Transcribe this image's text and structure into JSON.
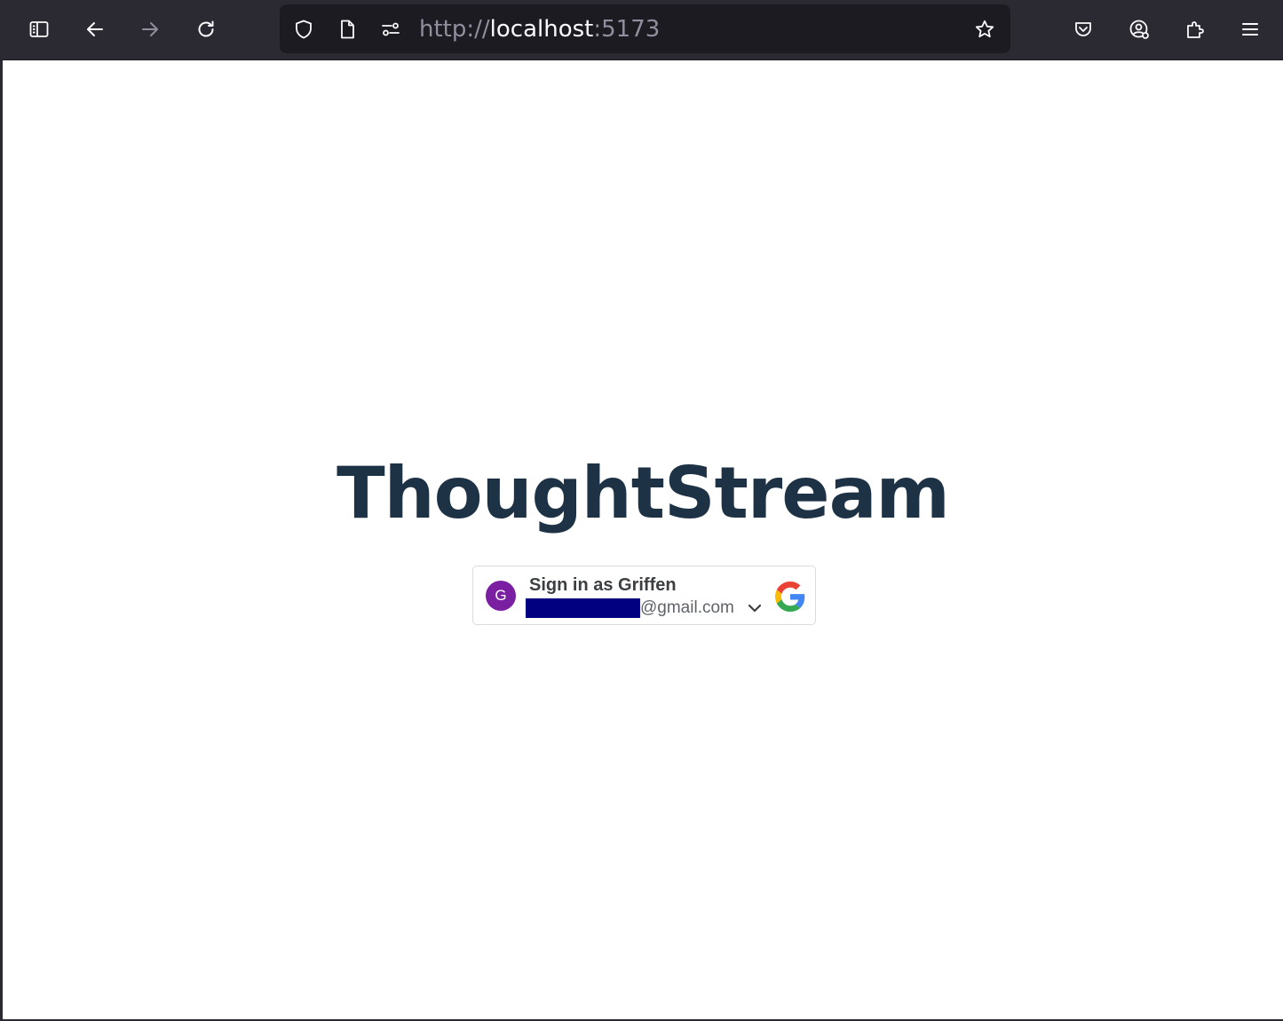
{
  "browser": {
    "url_scheme": "http://",
    "url_host": "localhost",
    "url_port": ":5173",
    "icons": {
      "sidebar": "sidebar-icon",
      "back": "arrow-left-icon",
      "forward": "arrow-right-icon",
      "reload": "reload-icon",
      "shield": "shield-icon",
      "page": "page-icon",
      "permissions": "permissions-icon",
      "bookmark": "star-icon",
      "pocket": "pocket-icon",
      "account": "account-icon",
      "extensions": "puzzle-icon",
      "menu": "hamburger-icon"
    }
  },
  "page": {
    "title": "ThoughtStream",
    "signin": {
      "avatar_letter": "G",
      "label": "Sign in as Griffen",
      "email_suffix": "@gmail.com"
    }
  },
  "colors": {
    "title": "#1e3246",
    "avatar": "#7b1fa2",
    "redaction": "#000080",
    "chrome": "#2b2a33"
  }
}
